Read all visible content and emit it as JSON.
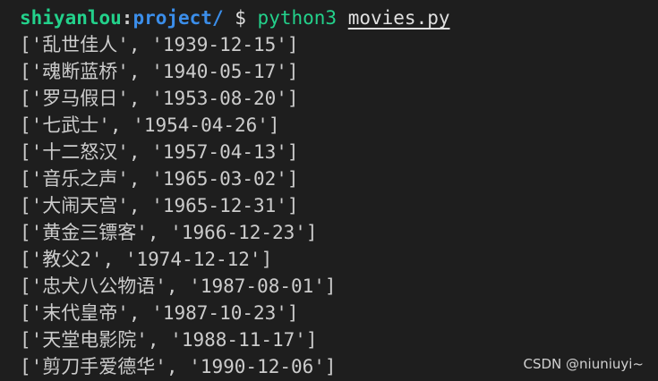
{
  "prompt": {
    "user": "shiyanlou",
    "separator": ":",
    "path": "project/",
    "dollar": " $ ",
    "command": "python3",
    "space": " ",
    "argument": "movies.py"
  },
  "output_lines": [
    "['乱世佳人', '1939-12-15']",
    "['魂断蓝桥', '1940-05-17']",
    "['罗马假日', '1953-08-20']",
    "['七武士', '1954-04-26']",
    "['十二怒汉', '1957-04-13']",
    "['音乐之声', '1965-03-02']",
    "['大闹天宫', '1965-12-31']",
    "['黄金三镖客', '1966-12-23']",
    "['教父2', '1974-12-12']",
    "['忠犬八公物语', '1987-08-01']",
    "['末代皇帝', '1987-10-23']",
    "['天堂电影院', '1988-11-17']",
    "['剪刀手爱德华', '1990-12-06']"
  ],
  "watermark": "CSDN @niuniuyi~",
  "colors": {
    "background": "#1e1e1e",
    "text": "#cccccc",
    "user": "#23d18b",
    "path": "#3b8eea",
    "command": "#23d18b"
  }
}
